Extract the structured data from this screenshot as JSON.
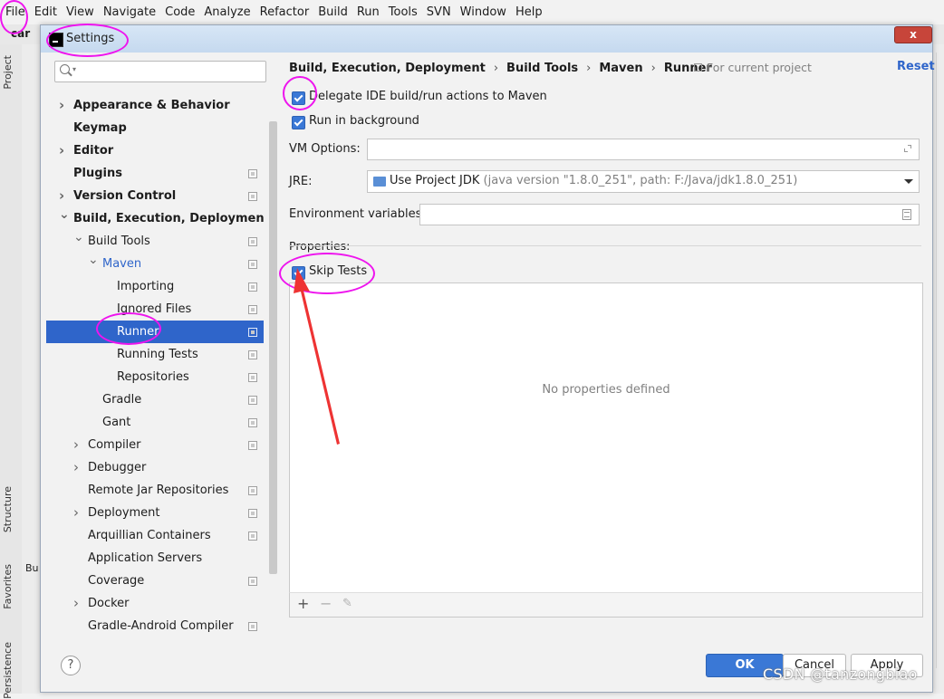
{
  "menubar": {
    "items": [
      "File",
      "Edit",
      "View",
      "Navigate",
      "Code",
      "Analyze",
      "Refactor",
      "Build",
      "Run",
      "Tools",
      "SVN",
      "Window",
      "Help"
    ]
  },
  "ide": {
    "project_crumb": "car",
    "side_tabs": [
      "Project",
      "Structure",
      "Favorites",
      "Persistence"
    ],
    "build_tab": "Bu"
  },
  "dialog": {
    "title": "Settings",
    "close_label": "x",
    "search": {
      "value": "",
      "placeholder": ""
    },
    "tree": [
      {
        "label": "Appearance & Behavior",
        "bold": true,
        "arrow": "right",
        "level": 0
      },
      {
        "label": "Keymap",
        "bold": true,
        "level": 0
      },
      {
        "label": "Editor",
        "bold": true,
        "arrow": "right",
        "level": 0
      },
      {
        "label": "Plugins",
        "bold": true,
        "level": 0,
        "project_icon": true
      },
      {
        "label": "Version Control",
        "bold": true,
        "arrow": "right",
        "level": 0,
        "project_icon": true
      },
      {
        "label": "Build, Execution, Deployment",
        "bold": true,
        "arrow": "down",
        "level": 0
      },
      {
        "label": "Build Tools",
        "arrow": "down",
        "level": 1,
        "project_icon": true
      },
      {
        "label": "Maven",
        "arrow": "down",
        "level": 2,
        "accent": true,
        "project_icon": true
      },
      {
        "label": "Importing",
        "level": 3,
        "project_icon": true
      },
      {
        "label": "Ignored Files",
        "level": 3,
        "project_icon": true
      },
      {
        "label": "Runner",
        "level": 3,
        "selected": true,
        "project_icon": true
      },
      {
        "label": "Running Tests",
        "level": 3,
        "project_icon": true
      },
      {
        "label": "Repositories",
        "level": 3,
        "project_icon": true
      },
      {
        "label": "Gradle",
        "level": 2,
        "project_icon": true
      },
      {
        "label": "Gant",
        "level": 2,
        "project_icon": true
      },
      {
        "label": "Compiler",
        "arrow": "right",
        "level": 1,
        "project_icon": true
      },
      {
        "label": "Debugger",
        "arrow": "right",
        "level": 1
      },
      {
        "label": "Remote Jar Repositories",
        "level": 1,
        "project_icon": true
      },
      {
        "label": "Deployment",
        "arrow": "right",
        "level": 1,
        "project_icon": true
      },
      {
        "label": "Arquillian Containers",
        "level": 1,
        "project_icon": true
      },
      {
        "label": "Application Servers",
        "level": 1
      },
      {
        "label": "Coverage",
        "level": 1,
        "project_icon": true
      },
      {
        "label": "Docker",
        "arrow": "right",
        "level": 1
      },
      {
        "label": "Gradle-Android Compiler",
        "level": 1,
        "project_icon": true
      }
    ],
    "breadcrumb": [
      "Build, Execution, Deployment",
      "Build Tools",
      "Maven",
      "Runner"
    ],
    "breadcrumb_sep": "›",
    "for_current_project": "For current project",
    "reset_label": "Reset",
    "delegate_label": "Delegate IDE build/run actions to Maven",
    "delegate_checked": true,
    "background_label": "Run in background",
    "background_checked": true,
    "vm_options_label": "VM Options:",
    "vm_options_value": "",
    "jre_label": "JRE:",
    "jre_main": "Use Project JDK",
    "jre_detail": "(java version \"1.8.0_251\", path: F:/Java/jdk1.8.0_251)",
    "env_label": "Environment variables:",
    "env_value": "",
    "properties_label": "Properties:",
    "skip_tests_label": "Skip Tests",
    "skip_tests_checked": true,
    "no_properties": "No properties defined",
    "toolbar": {
      "add": "+",
      "remove": "−",
      "edit": "✎"
    },
    "help_label": "?",
    "ok_label": "OK",
    "cancel_label": "Cancel",
    "apply_label": "Apply"
  },
  "watermark": "CSDN @tanzongbiao",
  "colors": {
    "accent": "#2f65ca",
    "selection": "#2f65ca",
    "annotation": "#ee14ee",
    "arrow": "#ee3333",
    "checkbox": "#3a78d6"
  },
  "icons": [
    "search-icon",
    "expand-icon",
    "folder-icon",
    "chevron-down-icon",
    "document-icon",
    "add-icon",
    "remove-icon",
    "edit-icon",
    "help-icon",
    "close-icon"
  ]
}
